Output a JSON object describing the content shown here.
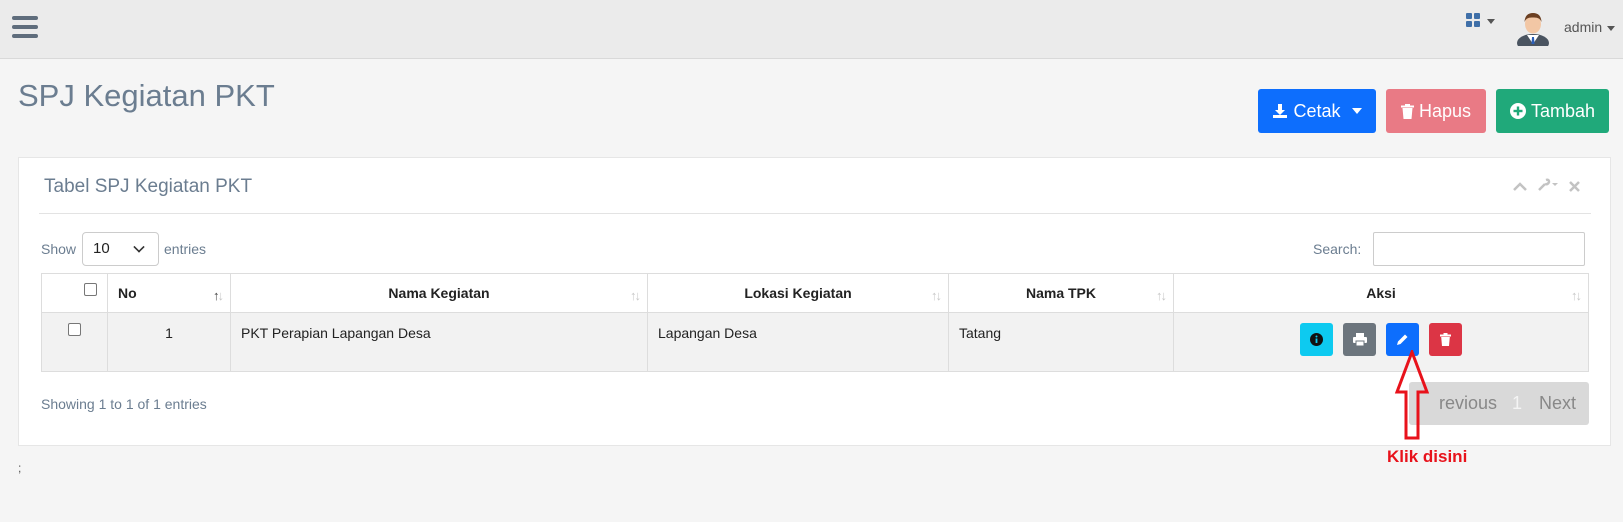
{
  "navbar": {
    "menu_icon": "hamburger-icon",
    "apps_icon": "grid-icon",
    "user_name": "admin"
  },
  "page": {
    "title": "SPJ Kegiatan PKT"
  },
  "toolbar": {
    "cetak_label": "Cetak",
    "hapus_label": "Hapus",
    "tambah_label": "Tambah"
  },
  "panel": {
    "title": "Tabel SPJ Kegiatan PKT",
    "show_label": "Show",
    "page_length": "10",
    "entries_label": "entries",
    "search_label": "Search:",
    "search_value": ""
  },
  "table": {
    "columns": [
      "No",
      "Nama Kegiatan",
      "Lokasi Kegiatan",
      "Nama TPK",
      "Aksi"
    ],
    "rows": [
      {
        "no": "1",
        "nama_kegiatan": "PKT Perapian Lapangan Desa",
        "lokasi_kegiatan": "Lapangan Desa",
        "nama_tpk": "Tatang"
      }
    ]
  },
  "footer": {
    "showing": "Showing 1 to 1 of 1 entries",
    "previous": "revious",
    "page": "1",
    "next": "Next"
  },
  "annotation": {
    "callout": "Klik disini"
  },
  "misc": {
    "bottom_text": ";"
  },
  "colors": {
    "primary": "#0d6efd",
    "danger": "#dc3545",
    "hapus": "#e97a85",
    "success": "#20a97a",
    "info": "#0dcaf0",
    "secondary": "#6c757d",
    "callout": "#e8121b"
  }
}
